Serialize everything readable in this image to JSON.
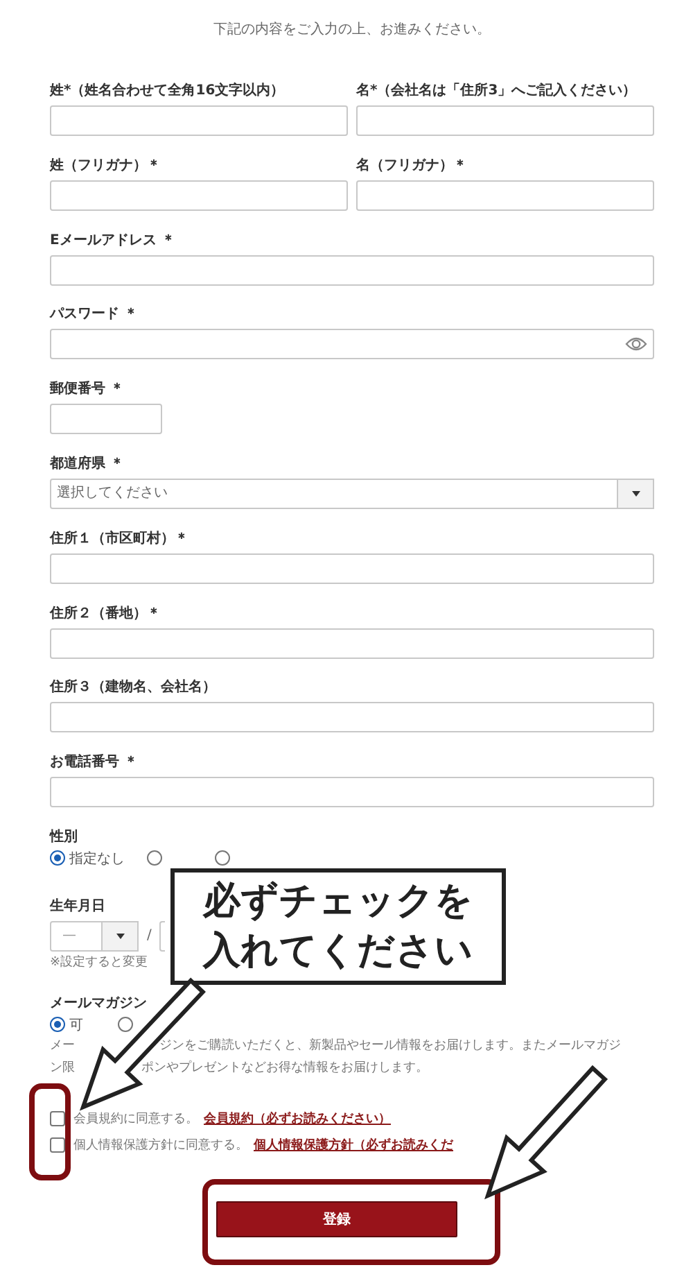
{
  "intro": "下記の内容をご入力の上、お進みください。",
  "fields": [
    {
      "kind": "pair",
      "items": [
        {
          "label": "姓*（姓名合わせて全角16文字以内）"
        },
        {
          "label": "名*（会社名は「住所3」へご記入ください）"
        }
      ]
    },
    {
      "kind": "pair",
      "items": [
        {
          "label": "姓（フリガナ）＊"
        },
        {
          "label": "名（フリガナ）＊"
        }
      ]
    },
    {
      "kind": "text",
      "label": "Eメールアドレス ＊"
    },
    {
      "kind": "password",
      "label": "パスワード ＊"
    },
    {
      "kind": "short",
      "label": "郵便番号 ＊"
    },
    {
      "kind": "select",
      "label": "都道府県 ＊",
      "placeholder": "選択してください"
    },
    {
      "kind": "text",
      "label": "住所１（市区町村）＊"
    },
    {
      "kind": "text",
      "label": "住所２（番地）＊"
    },
    {
      "kind": "text",
      "label": "住所３（建物名、会社名）"
    },
    {
      "kind": "text",
      "label": "お電話番号 ＊"
    },
    {
      "kind": "radio",
      "label": "性別",
      "options": [
        {
          "label": "指定なし",
          "selected": true
        },
        {
          "selected": false
        },
        {
          "selected": false
        }
      ]
    },
    {
      "kind": "date",
      "label": "生年月日",
      "year": "—",
      "separator": "/",
      "note": "※設定すると変更"
    },
    {
      "kind": "radio",
      "label": "メールマガジン",
      "options": [
        {
          "label": "可",
          "selected": true
        },
        {
          "selected": false
        }
      ],
      "note_lines": [
        [
          "メー",
          "ジンをご購読いただくと、新製品やセール情報をお届けします。またメールマガジ"
        ],
        [
          "ン限",
          "ポンやプレゼントなどお得な情報をお届けします。"
        ]
      ]
    }
  ],
  "agreements": [
    {
      "checked": false,
      "text": "会員規約に同意する。",
      "link": "会員規約（必ずお読みください）"
    },
    {
      "checked": false,
      "text": "個人情報保護方針に同意する。",
      "link": "個人情報保護方針（必ずお読みくだ"
    }
  ],
  "submit": "登録",
  "callout": [
    "必ずチェックを",
    "入れてください"
  ]
}
